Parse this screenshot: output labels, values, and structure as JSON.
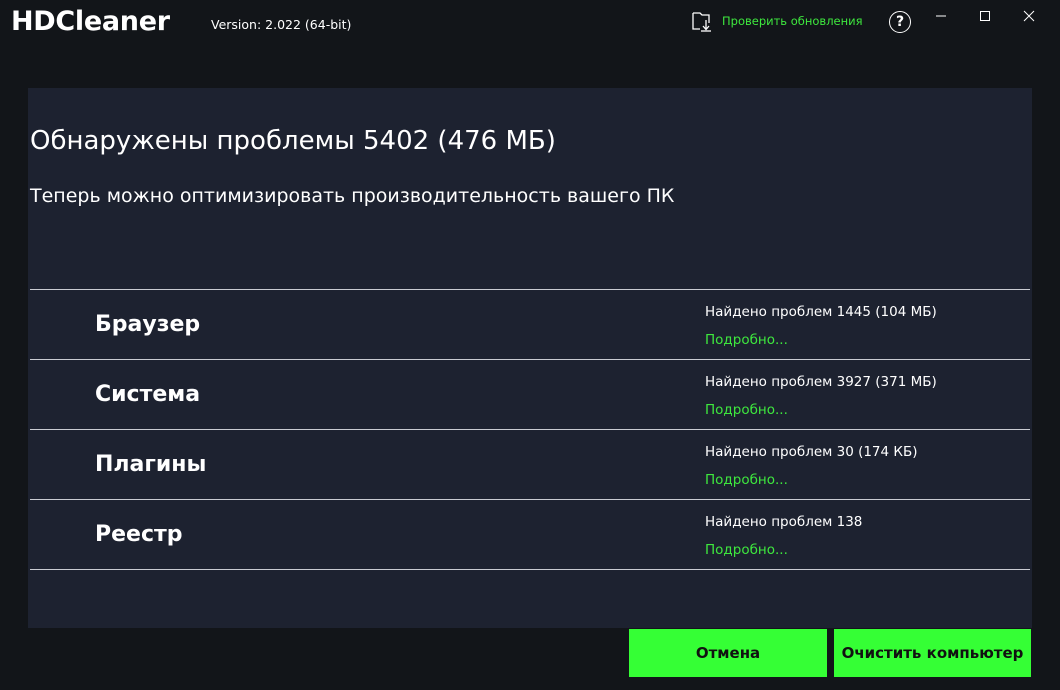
{
  "titlebar": {
    "app_title": "HDCleaner",
    "version": "Version: 2.022 (64-bit)",
    "update_label": "Проверить обновления",
    "help_label": "?",
    "icons": {
      "update": "download-folder-icon",
      "minimize": "minimize-icon",
      "maximize": "maximize-icon",
      "close": "close-icon"
    }
  },
  "main": {
    "headline": "Обнаружены проблемы 5402 (476 МБ)",
    "subline": "Теперь можно оптимизировать производительность вашего ПК",
    "categories": [
      {
        "name": "Браузер",
        "found": "Найдено проблем 1445 (104 МБ)",
        "details": "Подробно..."
      },
      {
        "name": "Система",
        "found": "Найдено проблем 3927 (371 МБ)",
        "details": "Подробно..."
      },
      {
        "name": "Плагины",
        "found": "Найдено проблем 30 (174 КБ)",
        "details": "Подробно..."
      },
      {
        "name": "Реестр",
        "found": "Найдено проблем 138",
        "details": "Подробно..."
      }
    ]
  },
  "footer": {
    "cancel_label": "Отмена",
    "clean_label": "Очистить компьютер"
  },
  "colors": {
    "accent_green": "#35ff35",
    "link_green": "#3ee83e",
    "panel_bg": "#1d2230",
    "window_bg": "#121519"
  }
}
